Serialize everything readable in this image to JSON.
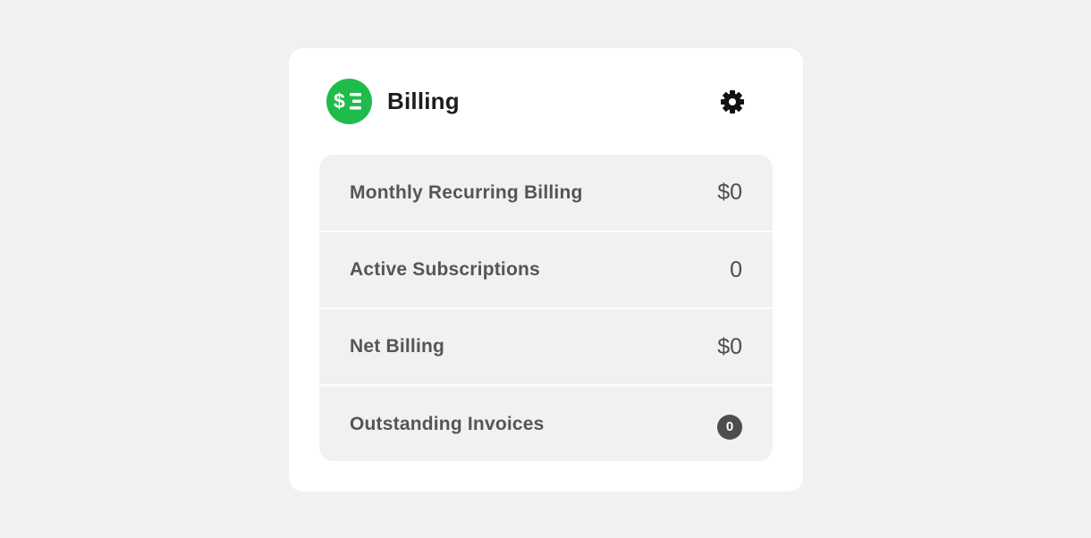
{
  "card": {
    "title": "Billing",
    "logo_icon": "dollar-list-icon",
    "settings_icon": "gear-icon",
    "accent_color": "#1fbc4b"
  },
  "stats": [
    {
      "label": "Monthly Recurring Billing",
      "value": "$0"
    },
    {
      "label": "Active Subscriptions",
      "value": "0"
    },
    {
      "label": "Net Billing",
      "value": "$0"
    },
    {
      "label": "Outstanding Invoices",
      "value": "0"
    }
  ]
}
